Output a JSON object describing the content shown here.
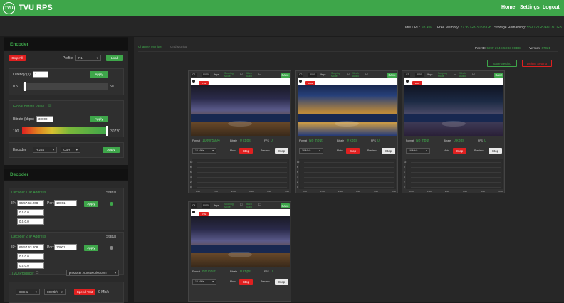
{
  "app": {
    "title": "TVU RPS",
    "logo_text": "TVU",
    "accent": "#3ea64a",
    "danger": "#e02020"
  },
  "nav": {
    "home": "Home",
    "settings": "Settings",
    "logout": "Logout"
  },
  "system": {
    "cpu_label": "Idle CPU:",
    "cpu_value": "98.4%",
    "mem_label": "Free Memory:",
    "mem_value": "27.99 GB/30.98 GB",
    "storage_label": "Storage Remaining:",
    "storage_value": "559.12 GB/460.80 GB"
  },
  "encoder": {
    "title": "Encoder",
    "stop_all": "Stop All",
    "profile_label": "Profile",
    "profile_value": "R1",
    "load": "Load",
    "latency_label": "Latency (s)",
    "latency_value": "1",
    "apply": "Apply",
    "latency_min": "0.5",
    "latency_max": "50",
    "latency_level": 0.02,
    "global_bitrate_label": "Global Bitrate Value",
    "bitrate_label": "Bitrate (kbps)",
    "bitrate_value": "30000",
    "bitrate_min": "100",
    "bitrate_max": "30720",
    "bitrate_level": 0.98,
    "encoder_label": "Encoder",
    "codec_value": "H.264",
    "mode_value": "CBR"
  },
  "decoder": {
    "title": "Decoder",
    "d1_label": "Decoder 1 IP Address",
    "d2_label": "Decoder 2 IP Address",
    "status_label": "Status",
    "ip_label": "IP:",
    "port_label": "Port:",
    "d1_ip": "66.57.63.208",
    "d1_ip2": "0.0.0.0",
    "d1_ip3": "0.0.0.0",
    "d1_port": "10001",
    "d2_ip": "66.57.63.208",
    "d2_ip2": "0.0.0.0",
    "d2_ip3": "0.0.0.0",
    "d2_port": "10001",
    "apply": "Apply",
    "d1_status_color": "#3ea64a",
    "d2_status_color": "#888888",
    "producer_label": "TVU Producer",
    "producer_host": "producer.tvunetworks.com",
    "dec_value": "DEC 1",
    "rate_value": "80 Mb/s",
    "speed_test": "Speed Test",
    "speed_value": "0 Mb/s"
  },
  "monitor": {
    "tab_channel": "Channel Monitor",
    "tab_grid": "Grid Monitor",
    "peer_label": "PeerID:",
    "peer_value": "589F 274C 5D83 8CDE",
    "version_label": "Version:",
    "version_value": "67021",
    "save_setting": "Save Setting",
    "delete_setting": "Delete Setting"
  },
  "channels": [
    {
      "id": "C1",
      "fps": "8000",
      "res": "Ifeps",
      "scoping": "Scoping Mode",
      "audio": "96-ch Audio",
      "save": "Save",
      "live": "LIVE",
      "format_label": "Format",
      "format_value": "1080i/5994",
      "bitrate_label": "Bitrate",
      "bitrate_value": "0 kbps",
      "fps_label": "FPS",
      "fps_value": "0",
      "rate": "16 Mb/s",
      "main_label": "Main",
      "main_btn": "Stop",
      "preview_label": "Preview",
      "preview_btn": "Stop",
      "ticks": [
        "0.00",
        "1:00",
        "2:00",
        "3:00",
        "4:00",
        "5:00"
      ],
      "yticks": [
        "10",
        "8",
        "6",
        "4",
        "2",
        "0"
      ]
    },
    {
      "id": "C2",
      "fps": "8000",
      "res": "Ifeps",
      "scoping": "Scoping Mode",
      "audio": "96-ch Audio",
      "save": "Save",
      "live": "LIVE",
      "format_label": "Format",
      "format_value": "No input",
      "bitrate_label": "Bitrate",
      "bitrate_value": "0 kbps",
      "fps_label": "FPS",
      "fps_value": "0",
      "rate": "16 Mb/s",
      "main_label": "Main",
      "main_btn": "Stop",
      "preview_label": "Preview",
      "preview_btn": "Stop",
      "ticks": [
        "0.00",
        "1:00",
        "2:00",
        "3:00",
        "4:00",
        "5:00"
      ],
      "yticks": [
        "10",
        "8",
        "6",
        "4",
        "2",
        "0"
      ]
    },
    {
      "id": "C3",
      "fps": "8000",
      "res": "Ifeps",
      "scoping": "Scoping Mode",
      "audio": "96-ch Audio",
      "save": "Save",
      "live": "LIVE",
      "format_label": "Format",
      "format_value": "No input",
      "bitrate_label": "Bitrate",
      "bitrate_value": "0 kbps",
      "fps_label": "FPS",
      "fps_value": "0",
      "rate": "16 Mb/s",
      "main_label": "Main",
      "main_btn": "Stop",
      "preview_label": "Preview",
      "preview_btn": "Stop",
      "ticks": [
        "0.00",
        "1:00",
        "2:00",
        "3:00",
        "4:00",
        "5:00"
      ],
      "yticks": [
        "10",
        "8",
        "6",
        "4",
        "2",
        "0"
      ]
    },
    {
      "id": "C4",
      "fps": "8000",
      "res": "Ifeps",
      "scoping": "Scoping Mode",
      "audio": "96-ch Audio",
      "save": "Save",
      "live": "LIVE",
      "format_label": "Format",
      "format_value": "No input",
      "bitrate_label": "Bitrate",
      "bitrate_value": "0 kbps",
      "fps_label": "FPS",
      "fps_value": "0",
      "rate": "16 Mb/s",
      "main_label": "Main",
      "main_btn": "Stop",
      "preview_label": "Preview",
      "preview_btn": "Stop",
      "ticks": [
        "0.00",
        "1:00",
        "2:00",
        "3:00",
        "4:00",
        "5:00"
      ],
      "yticks": [
        "10",
        "8",
        "6",
        "4",
        "2",
        "0"
      ]
    }
  ]
}
